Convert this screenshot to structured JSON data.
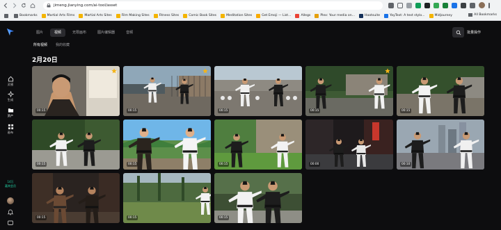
{
  "browser": {
    "url": "jimeng.jianying.com/ai-tool/asset",
    "bookmarks": [
      {
        "label": "Bookmarks",
        "color": "#5f6368"
      },
      {
        "label": "Martial Arts Films",
        "color": "#f4b400"
      },
      {
        "label": "Martial Arts Sites",
        "color": "#f4b400"
      },
      {
        "label": "Film Making Sites",
        "color": "#f4b400"
      },
      {
        "label": "Fitness Sites",
        "color": "#f4b400"
      },
      {
        "label": "Comic Book Sites",
        "color": "#f4b400"
      },
      {
        "label": "Meditation Sites",
        "color": "#f4b400"
      },
      {
        "label": "Get Emoji — List...",
        "color": "#f9ab00"
      },
      {
        "label": "Allegs",
        "color": "#ea4335"
      },
      {
        "label": "Plex: Your media on...",
        "color": "#e5a00d"
      },
      {
        "label": "Hootsuite",
        "color": "#143059"
      },
      {
        "label": "YayText: A text stylo...",
        "color": "#1a73e8"
      },
      {
        "label": "Midjourney",
        "color": "#f4b400"
      }
    ],
    "all_bookmarks": "All Bookmarks"
  },
  "sidebar": {
    "items": [
      {
        "label": "灵感",
        "icon": "home-icon"
      },
      {
        "label": "生成",
        "icon": "sparkle-icon"
      },
      {
        "label": "资产",
        "icon": "folder-icon"
      },
      {
        "label": "画布",
        "icon": "canvas-icon"
      }
    ],
    "credit_value": "14万",
    "credit_label": "嘉宾会员"
  },
  "nav": {
    "tabs": [
      "图片",
      "视频",
      "无限画布",
      "图片编辑器",
      "音频"
    ],
    "active_tab": 1,
    "batch_label": "批量操作"
  },
  "subtabs": {
    "items": [
      "所有视频",
      "我的收藏"
    ],
    "active": 0
  },
  "section_date": "2月20日",
  "accent": "#22d3a6",
  "videos": [
    {
      "duration": "00:15",
      "starred": true,
      "scene": "portrait"
    },
    {
      "duration": "00:15",
      "starred": true,
      "scene": "rooftop"
    },
    {
      "duration": "00:15",
      "starred": false,
      "scene": "rooftop2"
    },
    {
      "duration": "00:15",
      "starred": true,
      "scene": "garden"
    },
    {
      "duration": "00:15",
      "starred": false,
      "scene": "garden2"
    },
    {
      "duration": "00:15",
      "starred": false,
      "scene": "ivy"
    },
    {
      "duration": "00:15",
      "starred": false,
      "scene": "anime"
    },
    {
      "duration": "00:15",
      "starred": false,
      "scene": "anime2"
    },
    {
      "duration": "00:00",
      "starred": false,
      "scene": "night"
    },
    {
      "duration": "00:10",
      "starred": false,
      "scene": "city"
    },
    {
      "duration": "00:15",
      "starred": false,
      "scene": "dark"
    },
    {
      "duration": "00:15",
      "starred": false,
      "scene": "park"
    },
    {
      "duration": "00:15",
      "starred": false,
      "scene": "closeup"
    }
  ]
}
